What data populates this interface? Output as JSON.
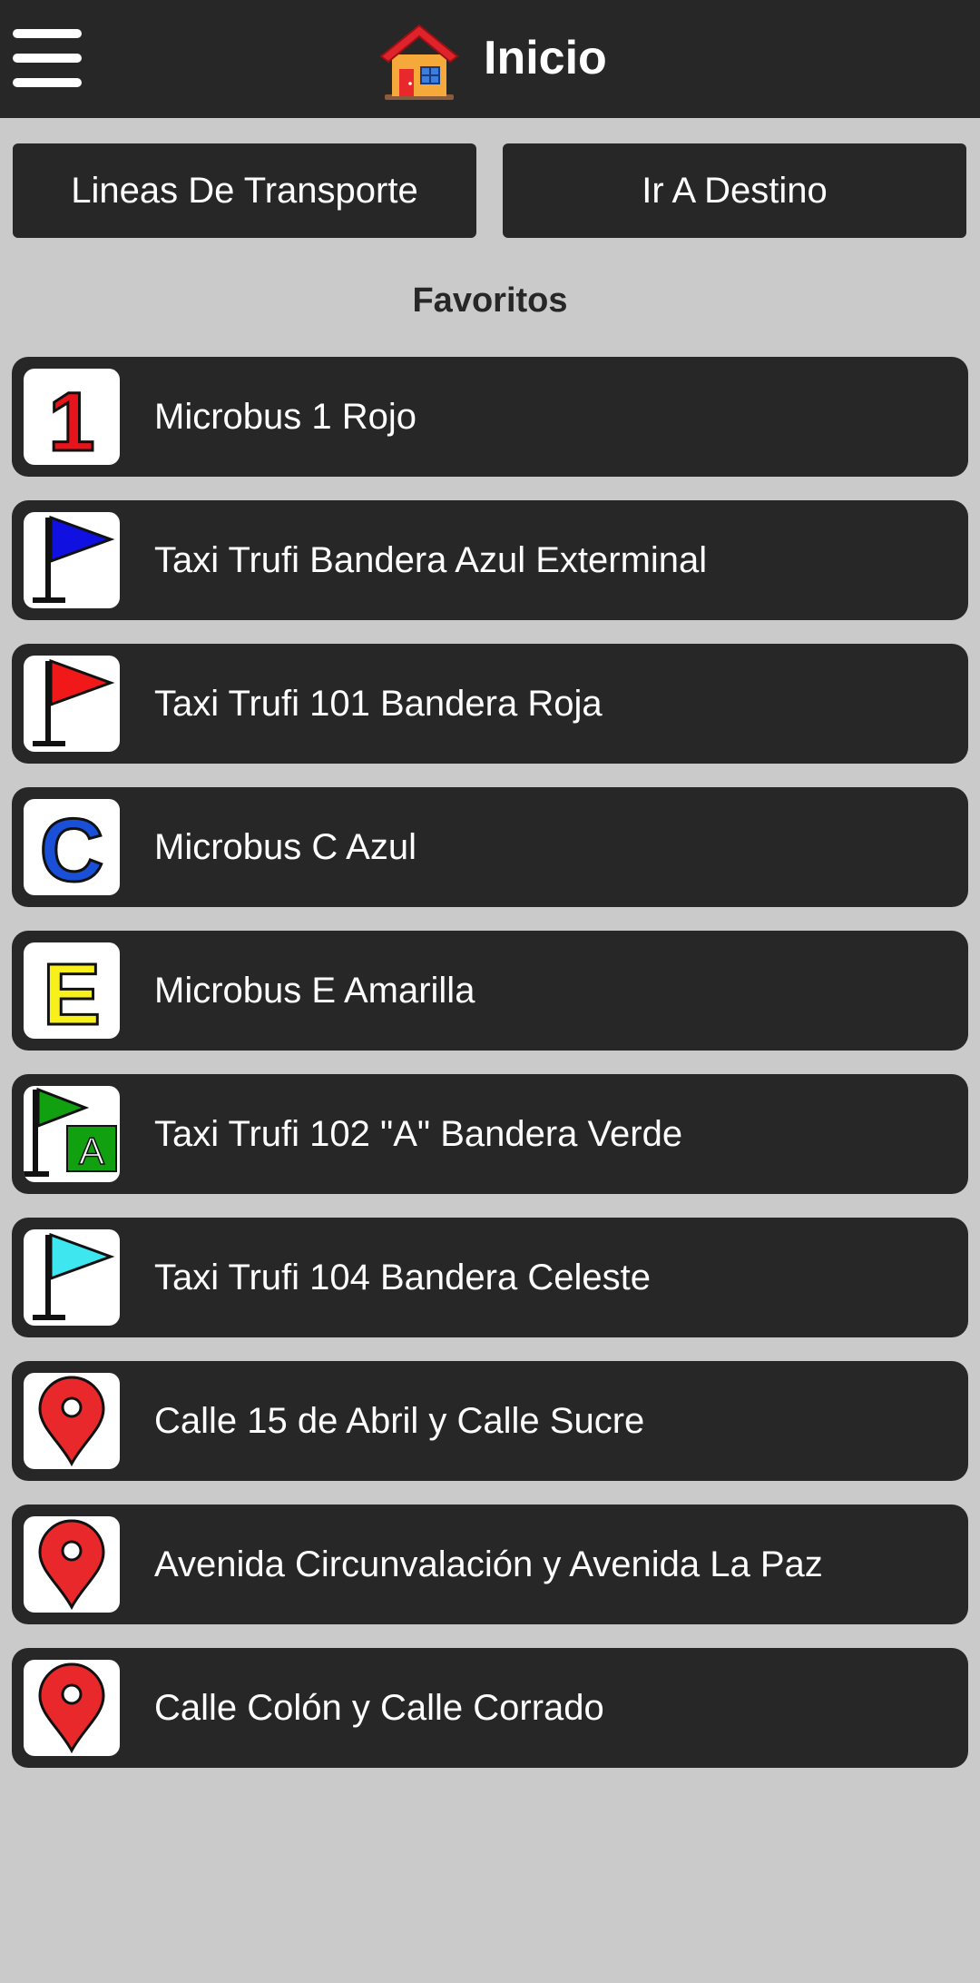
{
  "header": {
    "title": "Inicio",
    "menu_icon": "hamburger-menu-icon",
    "title_icon": "house-icon"
  },
  "actions": {
    "lines_label": "Lineas De Transporte",
    "destination_label": "Ir A Destino"
  },
  "favorites": {
    "title": "Favoritos",
    "items": [
      {
        "label": "Microbus 1 Rojo",
        "icon": "number-1-red-icon",
        "text": "1",
        "color": "#e8141c"
      },
      {
        "label": "Taxi Trufi Bandera Azul Exterminal",
        "icon": "blue-flag-icon",
        "color": "#1010e0"
      },
      {
        "label": "Taxi Trufi 101 Bandera Roja",
        "icon": "red-flag-icon",
        "color": "#f01818"
      },
      {
        "label": "Microbus C Azul",
        "icon": "letter-c-blue-icon",
        "text": "C",
        "color": "#1a4fd8"
      },
      {
        "label": "Microbus E Amarilla",
        "icon": "letter-e-yellow-icon",
        "text": "E",
        "color": "#f7f01a"
      },
      {
        "label": "Taxi Trufi 102 \"A\" Bandera Verde",
        "icon": "green-flag-a-icon",
        "text": "A",
        "color": "#10a010"
      },
      {
        "label": "Taxi Trufi 104 Bandera Celeste",
        "icon": "light-blue-flag-icon",
        "color": "#3ee6f0"
      },
      {
        "label": "Calle 15 de Abril y Calle Sucre",
        "icon": "location-pin-icon",
        "color": "#e8282a"
      },
      {
        "label": "Avenida Circunvalación y Avenida La Paz",
        "icon": "location-pin-icon",
        "color": "#e8282a"
      },
      {
        "label": "Calle Colón y Calle Corrado",
        "icon": "location-pin-icon",
        "color": "#e8282a"
      }
    ]
  }
}
